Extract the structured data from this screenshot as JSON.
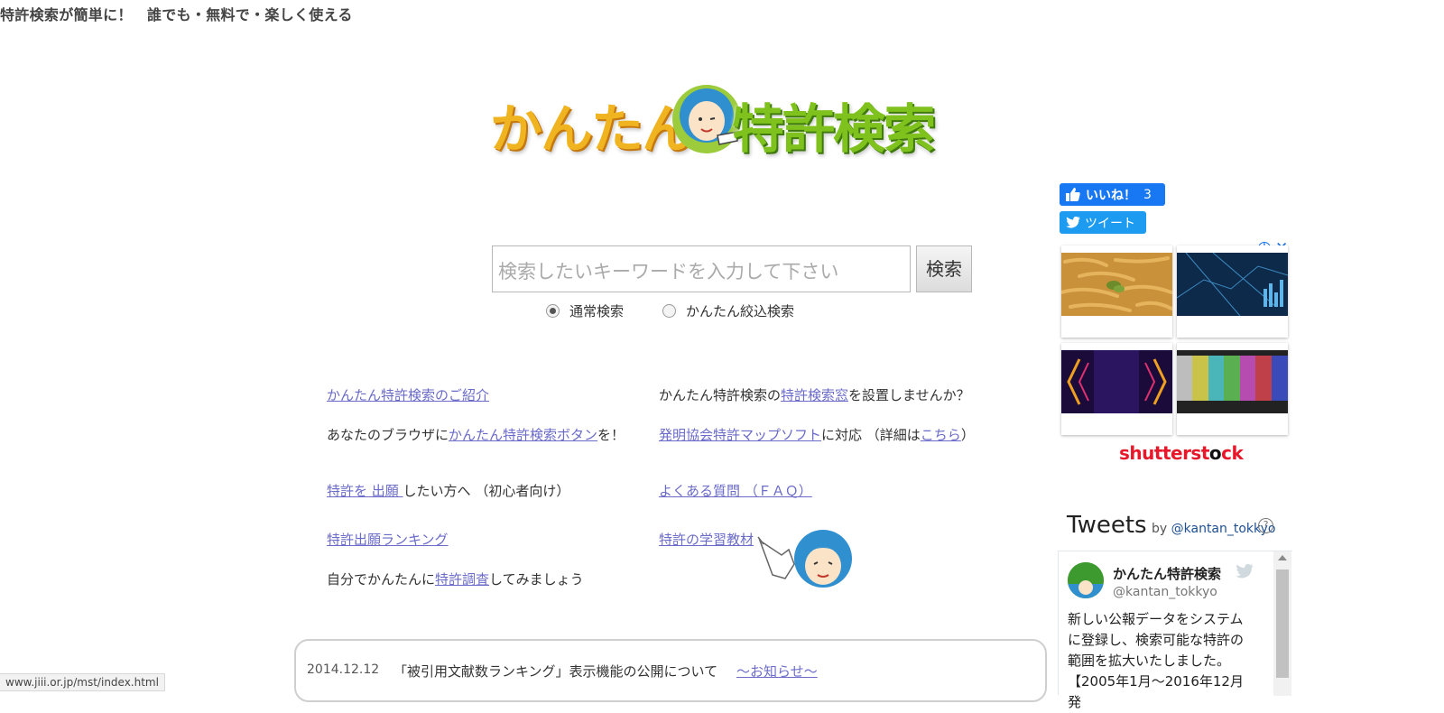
{
  "header": {
    "tagline": "特許検索が簡単に！　誰でも・無料で・楽しく使える"
  },
  "logo": {
    "left_text": "かんたん",
    "right_text": "特許検索"
  },
  "search": {
    "placeholder": "検索したいキーワードを入力して下さい",
    "button_label": "検索",
    "options": [
      {
        "label": "通常検索",
        "checked": true
      },
      {
        "label": "かんたん絞込検索",
        "checked": false
      }
    ]
  },
  "links": {
    "intro": "かんたん特許検索のご紹介",
    "install_pre": "かんたん特許検索の",
    "install_link": "特許検索窓",
    "install_post": "を設置しませんか？",
    "browser_pre": "あなたのブラウザに",
    "browser_link": "かんたん特許検索ボタン",
    "browser_post": "を！",
    "map_link": "発明協会特許マップソフト",
    "map_mid": "に対応 （詳細は",
    "map_link2": "こちら",
    "map_post": "）",
    "apply_link": "特許を 出願 ",
    "apply_post": "したい方へ （初心者向け）",
    "faq_link": "よくある質問 （ＦＡＱ）",
    "ranking_link": "特許出願ランキング",
    "learning_link": "特許の学習教材",
    "research_pre": "自分でかんたんに",
    "research_link": "特許調査",
    "research_post": "してみましょう"
  },
  "news": {
    "date": "2014.12.12",
    "title": "「被引用文献数ランキング」表示機能の公開について",
    "link": "～お知らせ～"
  },
  "status_bar": {
    "url": "www.jiii.or.jp/mst/index.html"
  },
  "social": {
    "like_label": "いいね！",
    "like_count": "3",
    "tweet_label": "ツイート"
  },
  "ad": {
    "brand_red": "shutterst",
    "brand_o": "o",
    "brand_end": "ck"
  },
  "twitter": {
    "heading": "Tweets",
    "by": "by",
    "account": "@kantan_tokkyo",
    "tweet_name": "かんたん特許検索",
    "tweet_handle": "@kantan_tokkyo",
    "tweet_text": "新しい公報データをシステムに登録し、検索可能な特許の範囲を拡大いたしました。【2005年1月～2016年12月 発"
  },
  "colors": {
    "link": "#6b6bc9",
    "facebook": "#1877f2",
    "twitter": "#1d9bf0",
    "logo_orange": "#f1b421",
    "logo_green": "#7fc21d"
  }
}
